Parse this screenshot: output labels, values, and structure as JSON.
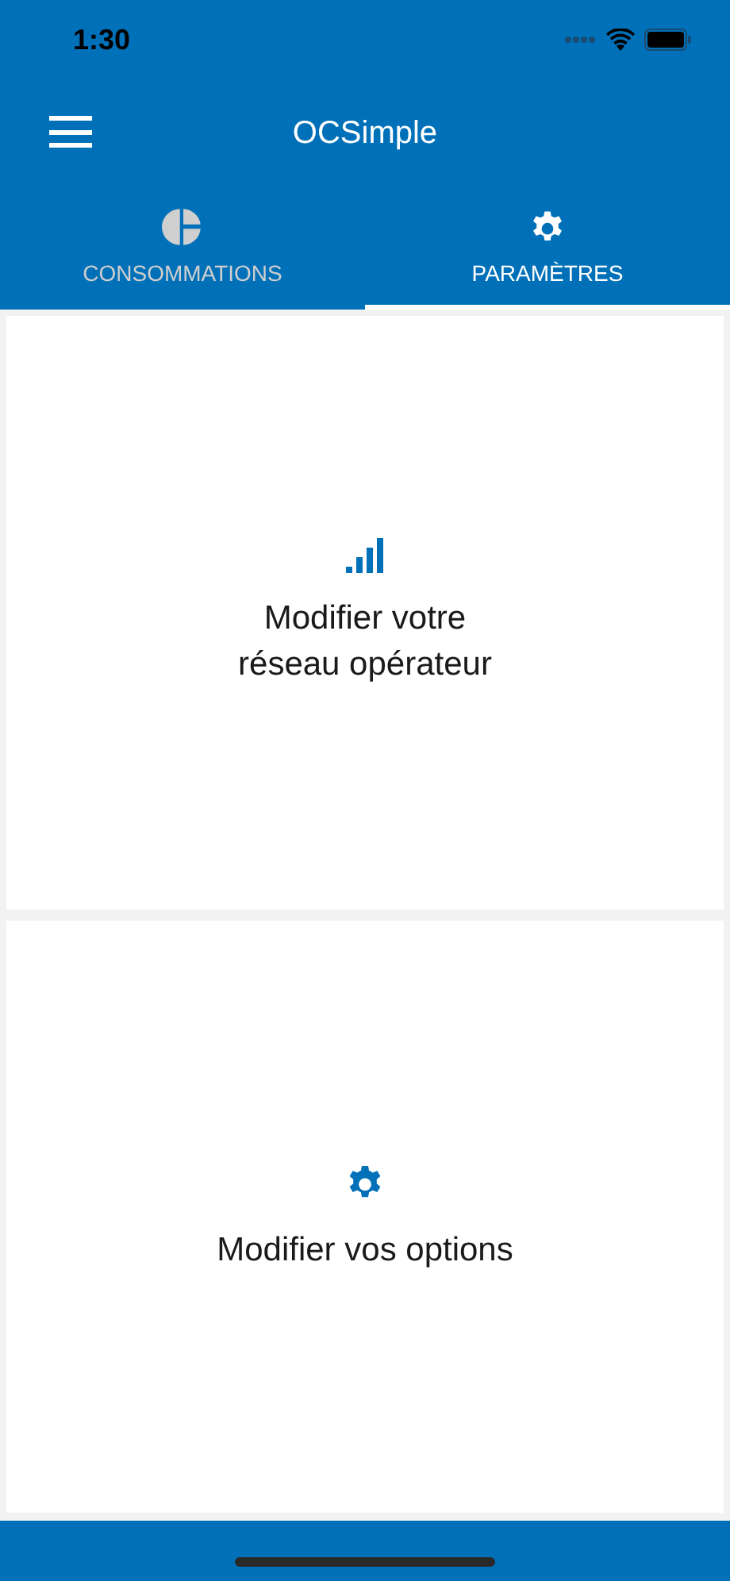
{
  "status_bar": {
    "time": "1:30"
  },
  "header": {
    "title": "OCSimple"
  },
  "tabs": [
    {
      "label": "CONSOMMATIONS",
      "selected": false,
      "kind": "chart"
    },
    {
      "label": "PARAMÈTRES",
      "selected": true,
      "kind": "settings"
    }
  ],
  "cards": [
    {
      "kind": "signal",
      "lines": [
        "Modifier votre",
        "réseau opérateur"
      ]
    },
    {
      "kind": "settings",
      "lines": [
        "Modifier vos options"
      ]
    }
  ]
}
